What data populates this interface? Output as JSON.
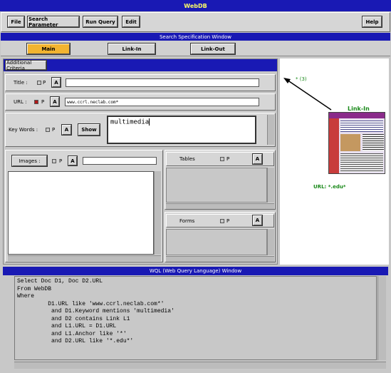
{
  "window": {
    "title": "WebDB"
  },
  "menubar": {
    "file": "File",
    "search_parameter": "Search Parameter",
    "run_query": "Run Query",
    "edit": "Edit",
    "help": "Help"
  },
  "spec_window": {
    "title": "Search Specification Window"
  },
  "tabs": {
    "main": "Main",
    "link_in": "Link-In",
    "link_out": "Link-Out"
  },
  "criteria": {
    "tab_label": "Additional Criteria",
    "title_label": "Title :",
    "p": "P",
    "a": "A",
    "title_value": "",
    "url_label": "URL :",
    "url_value": "www.ccrl.neclab.com*",
    "keywords_label": "Key Words :",
    "show_label": "Show",
    "keywords_value": "multimedia",
    "images_label": "Images :",
    "images_value": "",
    "tables_label": "Tables",
    "forms_label": "Forms"
  },
  "graph": {
    "edge_label": "* (3)",
    "node_label": "Link-In",
    "node_url": "URL: *.edu*"
  },
  "wql": {
    "title": "WQL (Web Query Language) Window",
    "lines": [
      "Select Doc D1, Doc D2.URL",
      "From WebDB",
      "Where",
      "         D1.URL like 'www.ccrl.neclab.com*'",
      "          and D1.Keyword mentions 'multimedia'",
      "          and D2 contains Link L1",
      "          and L1.URL = D1.URL",
      "          and L1.Anchor like '*'",
      "          and D2.URL like '*.edu*'"
    ]
  },
  "colors": {
    "title_bar": "#1919b4",
    "title_text": "#ffff66",
    "main_tab": "#f2b430",
    "graph_green": "#1a8a1a",
    "checked": "#b01818"
  }
}
